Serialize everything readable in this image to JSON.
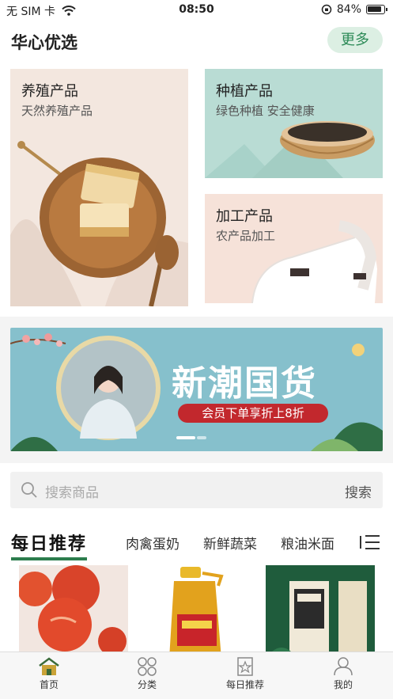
{
  "status_bar": {
    "carrier": "无 SIM 卡",
    "time": "08:50",
    "battery": "84%"
  },
  "header": {
    "title": "华心优选",
    "more_label": "更多"
  },
  "categories": [
    {
      "title": "养殖产品",
      "subtitle": "天然养殖产品"
    },
    {
      "title": "种植产品",
      "subtitle": "绿色种植 安全健康"
    },
    {
      "title": "加工产品",
      "subtitle": "农产品加工"
    }
  ],
  "banner": {
    "title": "新潮国货",
    "subtitle": "会员下单享折上8折",
    "slide_count": 3,
    "active_slide": 1
  },
  "search": {
    "placeholder": "搜索商品",
    "button_label": "搜索"
  },
  "tabs": {
    "active": "每日推荐",
    "items": [
      "肉禽蛋奶",
      "新鲜蔬菜",
      "粮油米面"
    ]
  },
  "tabbar": {
    "items": [
      "首页",
      "分类",
      "每日推荐",
      "我的"
    ],
    "active_index": 0
  },
  "colors": {
    "accent": "#2c7d4d",
    "more_bg": "#dcefe3",
    "banner_red": "#c2282d"
  }
}
